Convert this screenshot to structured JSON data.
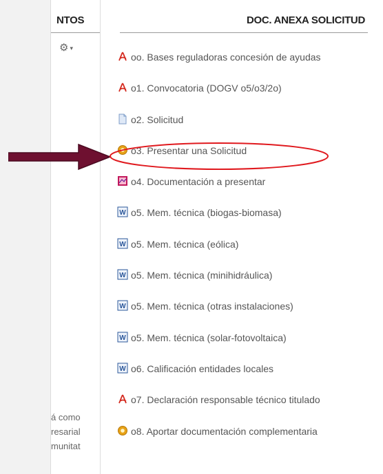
{
  "left_panel": {
    "title": "NTOS",
    "snippets": [
      "á como",
      "resarial",
      "munitat"
    ]
  },
  "right_panel": {
    "title": "DOC. ANEXA SOLICITUD",
    "items": [
      {
        "label": "oo. Bases reguladoras concesión de ayudas",
        "icon": "pdf-icon"
      },
      {
        "label": "o1. Convocatoria (DOGV o5/o3/2o)",
        "icon": "pdf-icon"
      },
      {
        "label": "o2. Solicitud",
        "icon": "file-icon"
      },
      {
        "label": "o3. Presentar una Solicitud",
        "icon": "gear-icon"
      },
      {
        "label": "o4. Documentación a presentar",
        "icon": "document-image-icon"
      },
      {
        "label": "o5. Mem. técnica (biogas-biomasa)",
        "icon": "word-icon"
      },
      {
        "label": "o5. Mem. técnica (eólica)",
        "icon": "word-icon"
      },
      {
        "label": "o5. Mem. técnica (minihidráulica)",
        "icon": "word-icon"
      },
      {
        "label": "o5. Mem. técnica (otras instalaciones)",
        "icon": "word-icon"
      },
      {
        "label": "o5. Mem. técnica (solar-fotovoltaica)",
        "icon": "word-icon"
      },
      {
        "label": "o6. Calificación entidades locales",
        "icon": "word-icon"
      },
      {
        "label": "o7. Declaración responsable técnico titulado",
        "icon": "pdf-icon"
      },
      {
        "label": "o8. Aportar documentación complementaria",
        "icon": "gear-icon"
      }
    ]
  },
  "annotation": {
    "arrow_color": "#6e1030",
    "ellipse_color": "#e0191e"
  }
}
